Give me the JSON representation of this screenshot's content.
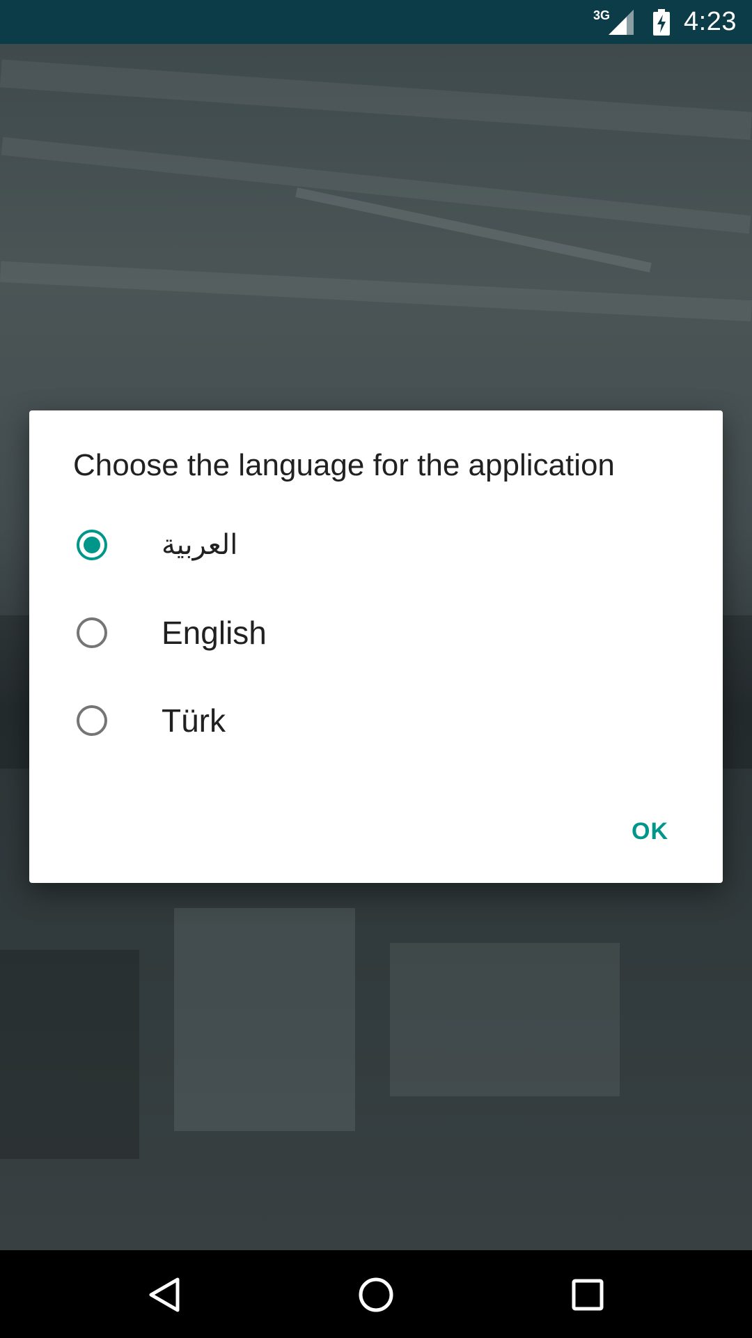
{
  "status_bar": {
    "network": "3G",
    "time": "4:23",
    "icons": [
      "signal-icon",
      "battery-icon"
    ]
  },
  "dialog": {
    "title": "Choose the language for the application",
    "options": [
      {
        "label": "العربية",
        "selected": true
      },
      {
        "label": "English",
        "selected": false
      },
      {
        "label": "Türk",
        "selected": false
      }
    ],
    "ok_label": "OK"
  },
  "nav_bar": {
    "icons": [
      "back-icon",
      "home-icon",
      "recents-icon"
    ]
  },
  "colors": {
    "status_bar": "#0c3c47",
    "accent": "#00968a",
    "dialog_bg": "#ffffff",
    "text_primary": "#212121",
    "radio_unchecked": "#757575"
  }
}
